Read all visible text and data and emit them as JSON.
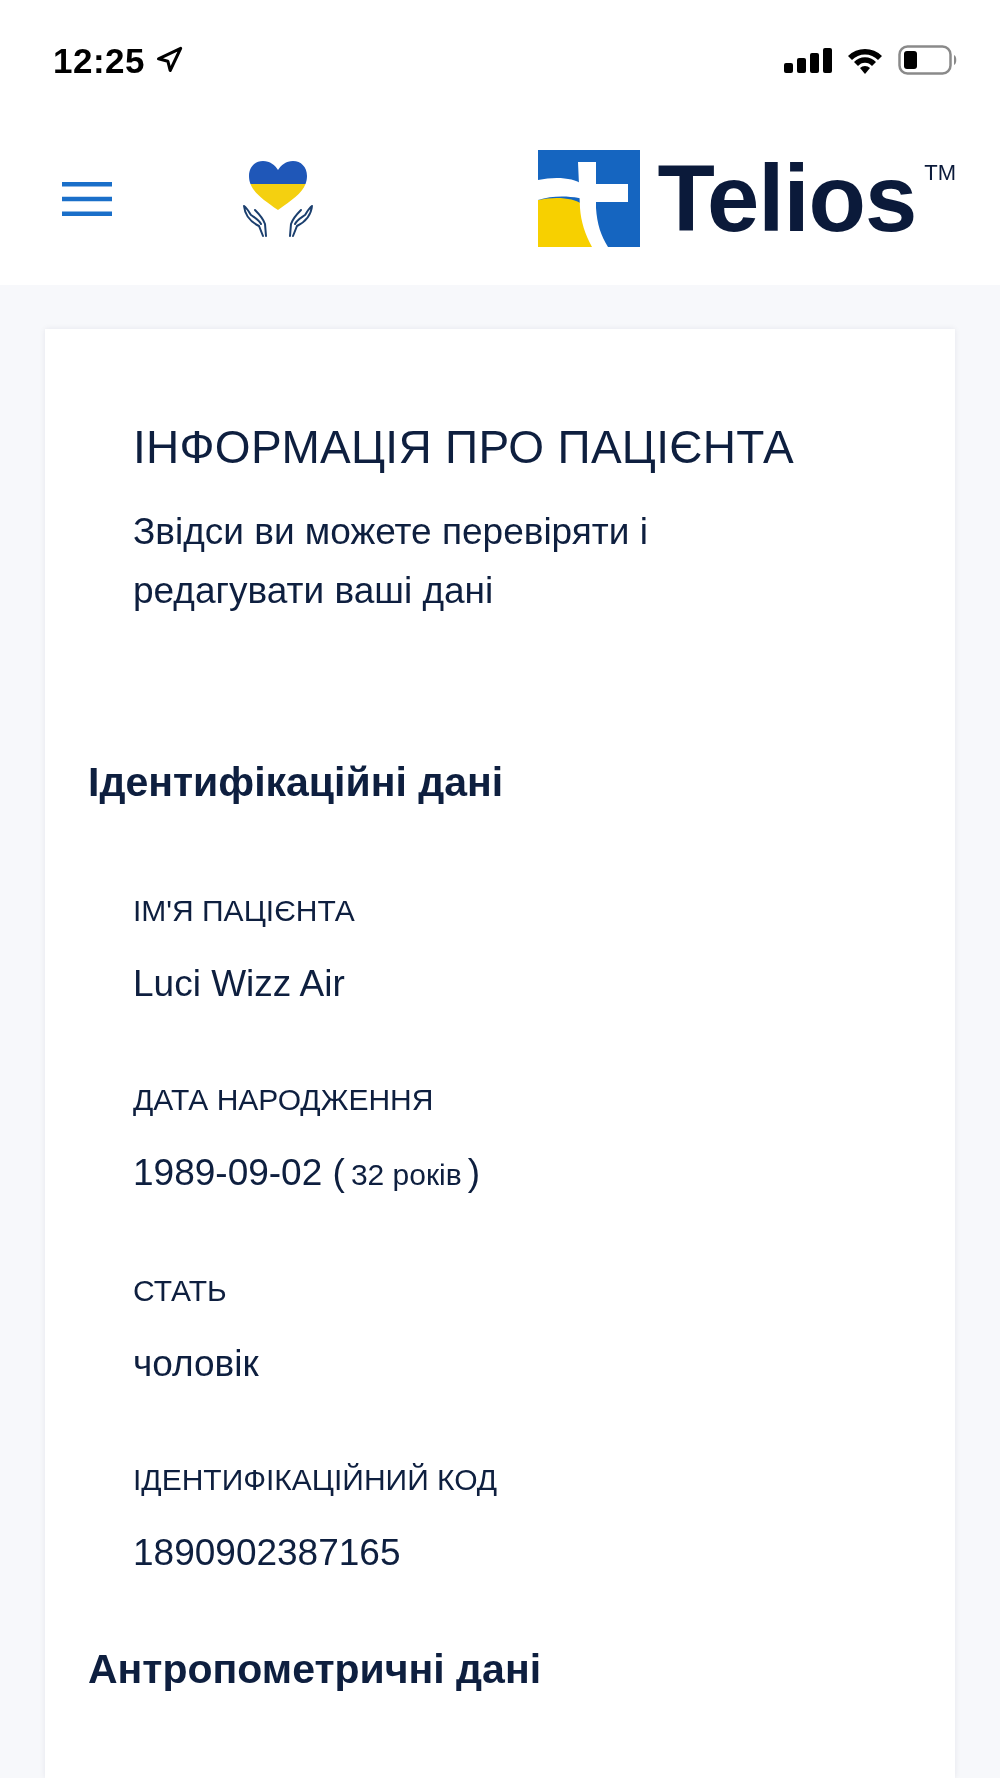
{
  "status_bar": {
    "time": "12:25"
  },
  "header": {
    "logo": {
      "name": "Telios",
      "mark": "TM"
    }
  },
  "page": {
    "title": "ІНФОРМАЦІЯ ПРО ПАЦІЄНТА",
    "subtitle": "Звідси ви можете перевіряти і редагувати ваші дані"
  },
  "sections": [
    {
      "heading": "Ідентифікаційні дані",
      "fields": [
        {
          "label": "ІМ'Я ПАЦІЄНТА",
          "value": "Luci Wizz Air"
        },
        {
          "label": "ДАТА НАРОДЖЕННЯ",
          "value": "1989-09-02 (",
          "age": "32 років",
          "value_close": ")"
        },
        {
          "label": "СТАТЬ",
          "value": "чоловік"
        },
        {
          "label": "ІДЕНТИФІКАЦІЙНИЙ КОД",
          "value": "1890902387165"
        }
      ]
    },
    {
      "heading": "Антропометричні дані"
    }
  ]
}
